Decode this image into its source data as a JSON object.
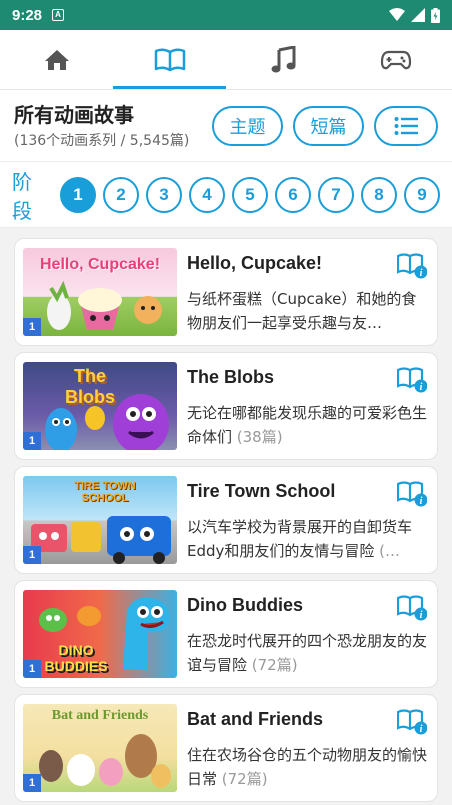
{
  "status_bar": {
    "time": "9:28",
    "notification_icon": "A"
  },
  "tabs": [
    {
      "name": "home-icon"
    },
    {
      "name": "book-icon"
    },
    {
      "name": "music-note-icon"
    },
    {
      "name": "gamepad-icon"
    }
  ],
  "header": {
    "title": "所有动画故事",
    "subtitle": "(136个动画系列 / 5,545篇)",
    "buttons": {
      "theme": "主题",
      "short": "短篇"
    }
  },
  "stages": {
    "label": "阶段",
    "items": [
      "1",
      "2",
      "3",
      "4",
      "5",
      "6",
      "7",
      "8",
      "9"
    ],
    "selected": "1"
  },
  "series": [
    {
      "name": "Hello, Cupcake!",
      "desc": "与纸杯蛋糕（Cupcake）和她的食物朋友们一起享受乐趣与友…",
      "count": "",
      "level": "1",
      "thumb_title": "Hello, Cupcake!"
    },
    {
      "name": "The Blobs",
      "desc": "无论在哪都能发现乐趣的可爱彩色生命体们 ",
      "count": "(38篇)",
      "level": "1",
      "thumb_title": "The Blobs"
    },
    {
      "name": "Tire Town School",
      "desc": "以汽车学校为背景展开的自卸货车Eddy和朋友们的友情与冒险 ",
      "count": "(…",
      "level": "1",
      "thumb_title": "TIRE TOWN SCHOOL"
    },
    {
      "name": "Dino Buddies",
      "desc": "在恐龙时代展开的四个恐龙朋友的友谊与冒险 ",
      "count": "(72篇)",
      "level": "1",
      "thumb_title": "DINO BUDDIES"
    },
    {
      "name": "Bat and Friends",
      "desc": "住在农场谷仓的五个动物朋友的愉快日常 ",
      "count": "(72篇)",
      "level": "1",
      "thumb_title": "Bat and Friends"
    }
  ],
  "colors": {
    "accent": "#1a9ed9",
    "status_bar": "#1f8a72",
    "badge": "#2f6fd6"
  }
}
